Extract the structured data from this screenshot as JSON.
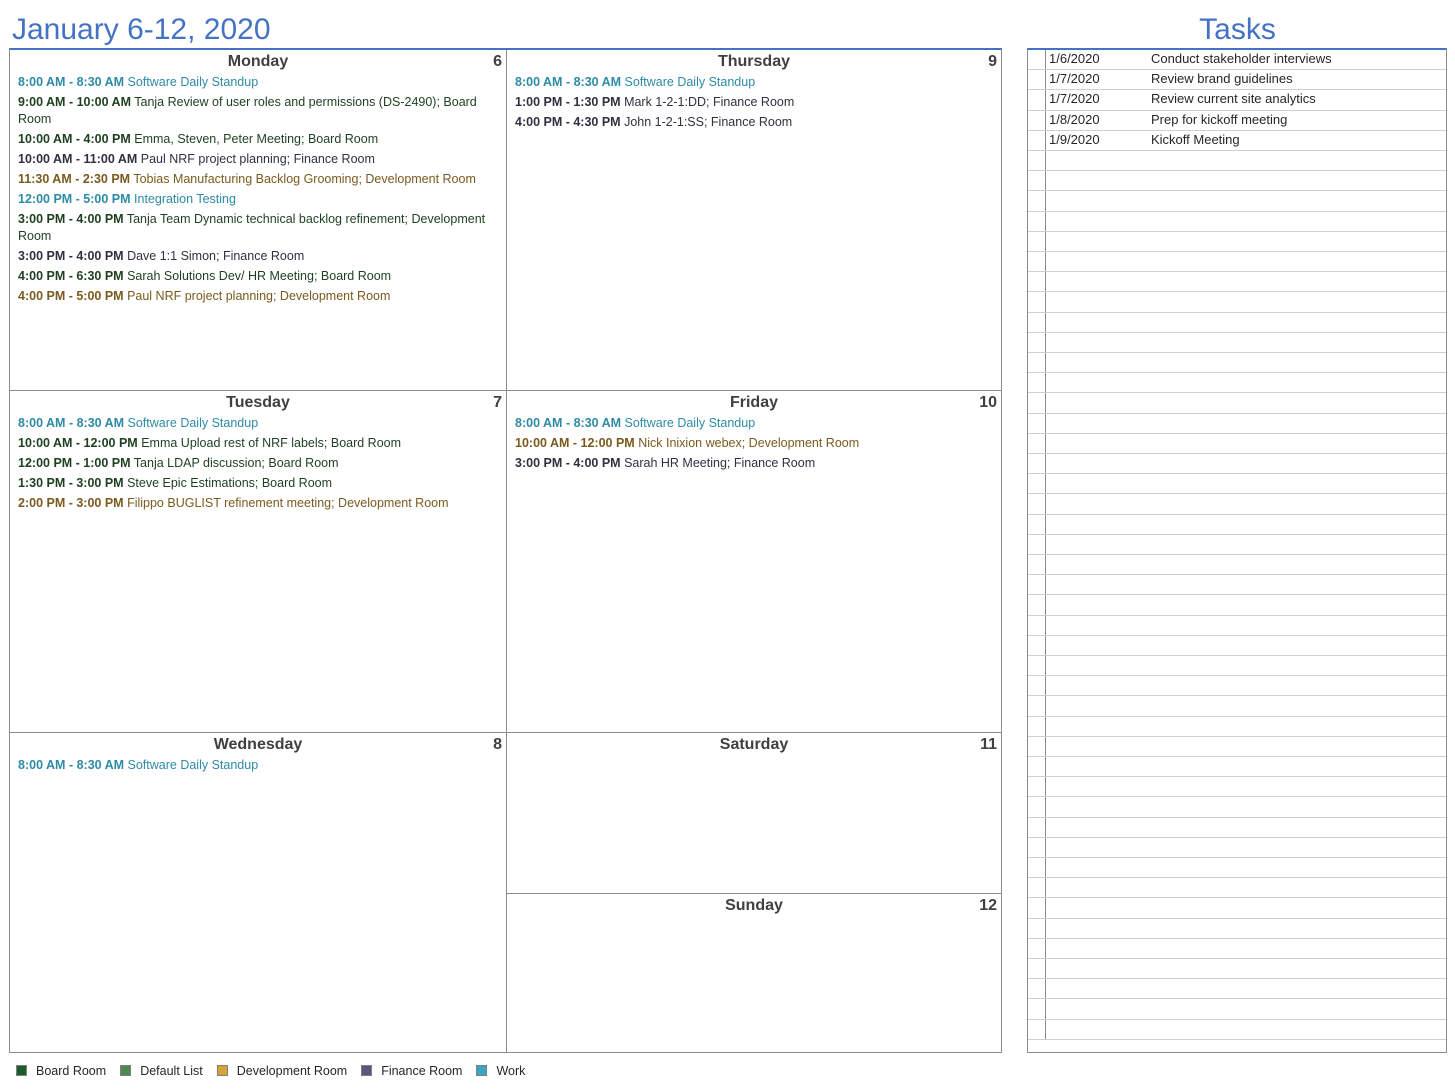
{
  "header": {
    "week_title": "January 6-12, 2020",
    "tasks_title": "Tasks"
  },
  "colors": {
    "board": "#1e5b2a",
    "default": "#4e8a50",
    "dev": "#d6a33a",
    "fin": "#5b567e",
    "work": "#3aa6c4",
    "title": "#4472c4"
  },
  "days": {
    "monday": {
      "name": "Monday",
      "num": "6",
      "events": [
        {
          "time": "8:00 AM - 8:30 AM",
          "text": "Software Daily Standup",
          "cat": "work"
        },
        {
          "time": "9:00 AM - 10:00 AM",
          "text": "Tanja Review of user roles and permissions (DS-2490); Board Room",
          "cat": "board"
        },
        {
          "time": "10:00 AM - 4:00 PM",
          "text": "Emma, Steven, Peter Meeting; Board Room",
          "cat": "board"
        },
        {
          "time": "10:00 AM - 11:00 AM",
          "text": "Paul NRF project planning; Finance Room",
          "cat": "fin"
        },
        {
          "time": "11:30 AM - 2:30 PM",
          "text": "Tobias Manufacturing Backlog Grooming; Development Room",
          "cat": "dev"
        },
        {
          "time": "12:00 PM - 5:00 PM",
          "text": "Integration Testing",
          "cat": "work"
        },
        {
          "time": "3:00 PM - 4:00 PM",
          "text": "Tanja Team Dynamic technical backlog refinement; Development Room",
          "cat": "board"
        },
        {
          "time": "3:00 PM - 4:00 PM",
          "text": "Dave 1:1 Simon; Finance Room",
          "cat": "fin"
        },
        {
          "time": "4:00 PM - 6:30 PM",
          "text": "Sarah Solutions Dev/ HR Meeting; Board Room",
          "cat": "board"
        },
        {
          "time": "4:00 PM - 5:00 PM",
          "text": "Paul NRF project planning; Development Room",
          "cat": "dev"
        }
      ]
    },
    "tuesday": {
      "name": "Tuesday",
      "num": "7",
      "events": [
        {
          "time": "8:00 AM - 8:30 AM",
          "text": "Software Daily Standup",
          "cat": "work"
        },
        {
          "time": "10:00 AM - 12:00 PM",
          "text": "Emma Upload rest of NRF labels; Board Room",
          "cat": "board"
        },
        {
          "time": "12:00 PM - 1:00 PM",
          "text": "Tanja LDAP discussion; Board Room",
          "cat": "board"
        },
        {
          "time": "1:30 PM - 3:00 PM",
          "text": "Steve Epic Estimations; Board Room",
          "cat": "board"
        },
        {
          "time": "2:00 PM - 3:00 PM",
          "text": "Filippo BUGLIST refinement meeting; Development Room",
          "cat": "dev"
        }
      ]
    },
    "wednesday": {
      "name": "Wednesday",
      "num": "8",
      "events": [
        {
          "time": "8:00 AM - 8:30 AM",
          "text": "Software Daily Standup",
          "cat": "work"
        }
      ]
    },
    "thursday": {
      "name": "Thursday",
      "num": "9",
      "events": [
        {
          "time": "8:00 AM - 8:30 AM",
          "text": "Software Daily Standup",
          "cat": "work"
        },
        {
          "time": "1:00 PM - 1:30 PM",
          "text": "Mark 1-2-1:DD; Finance Room",
          "cat": "fin"
        },
        {
          "time": "4:00 PM - 4:30 PM",
          "text": "John 1-2-1:SS; Finance Room",
          "cat": "fin"
        }
      ]
    },
    "friday": {
      "name": "Friday",
      "num": "10",
      "events": [
        {
          "time": "8:00 AM - 8:30 AM",
          "text": "Software Daily Standup",
          "cat": "work"
        },
        {
          "time": "10:00 AM - 12:00 PM",
          "text": "Nick Inixion webex; Development Room",
          "cat": "dev"
        },
        {
          "time": "3:00 PM - 4:00 PM",
          "text": "Sarah HR Meeting; Finance Room",
          "cat": "fin"
        }
      ]
    },
    "saturday": {
      "name": "Saturday",
      "num": "11",
      "events": []
    },
    "sunday": {
      "name": "Sunday",
      "num": "12",
      "events": []
    }
  },
  "tasks": [
    {
      "date": "1/6/2020",
      "name": "Conduct stakeholder interviews"
    },
    {
      "date": "1/7/2020",
      "name": "Review brand guidelines"
    },
    {
      "date": "1/7/2020",
      "name": "Review current site analytics"
    },
    {
      "date": "1/8/2020",
      "name": "Prep for kickoff meeting"
    },
    {
      "date": "1/9/2020",
      "name": "Kickoff Meeting"
    }
  ],
  "legend": [
    {
      "label": "Board Room",
      "color": "#1e5b2a"
    },
    {
      "label": "Default List",
      "color": "#4e8a50"
    },
    {
      "label": "Development Room",
      "color": "#d6a33a"
    },
    {
      "label": "Finance Room",
      "color": "#5b567e"
    },
    {
      "label": "Work",
      "color": "#3aa6c4"
    }
  ]
}
